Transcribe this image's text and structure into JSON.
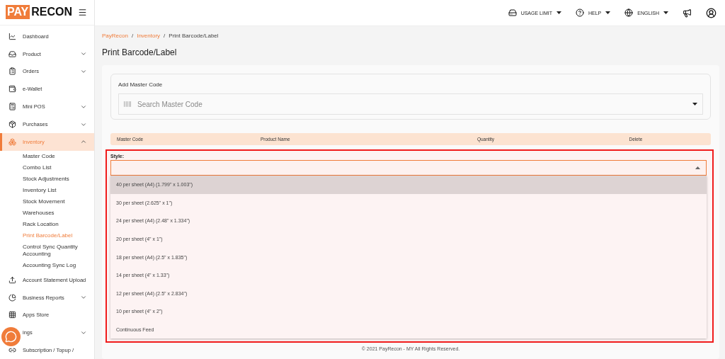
{
  "logo": {
    "part_1": "PAY",
    "part_2": "RECON"
  },
  "sidebar": {
    "items": [
      {
        "label": "Dashboard",
        "kind": "link",
        "selected": false
      },
      {
        "label": "Product",
        "kind": "group",
        "expanded": false,
        "selected": false
      },
      {
        "label": "Orders",
        "kind": "group",
        "expanded": false,
        "selected": false
      },
      {
        "label": "e-Wallet",
        "kind": "link",
        "selected": false
      },
      {
        "label": "Mini POS",
        "kind": "group",
        "expanded": false,
        "selected": false
      },
      {
        "label": "Purchases",
        "kind": "group",
        "expanded": false,
        "selected": false
      },
      {
        "label": "Inventory",
        "kind": "group",
        "expanded": true,
        "selected": true,
        "children": [
          {
            "label": "Master Code",
            "selected": false
          },
          {
            "label": "Combo List",
            "selected": false
          },
          {
            "label": "Stock Adjustments",
            "selected": false
          },
          {
            "label": "Inventory List",
            "selected": false
          },
          {
            "label": "Stock Movement",
            "selected": false
          },
          {
            "label": "Warehouses",
            "selected": false
          },
          {
            "label": "Rack Location",
            "selected": false
          },
          {
            "label": "Print Barcode/Label",
            "selected": true
          },
          {
            "label": "Control Sync Quantity Accounting",
            "selected": false
          },
          {
            "label": "Accounting Sync Log",
            "selected": false
          }
        ]
      },
      {
        "label": "Account Statement Upload",
        "kind": "link",
        "selected": false
      },
      {
        "label": "Business Reports",
        "kind": "group",
        "expanded": false,
        "selected": false
      },
      {
        "label": "Apps Store",
        "kind": "link",
        "selected": false
      },
      {
        "label": "ings",
        "kind": "group",
        "expanded": false,
        "selected": false
      },
      {
        "label": "Subscription / Topup /",
        "kind": "link",
        "selected": false
      }
    ]
  },
  "topbar": {
    "menus": [
      "USAGE LIMIT",
      "HELP",
      "ENGLISH"
    ]
  },
  "breadcrumb": [
    "PayRecon",
    "Inventory",
    "Print Barcode/Label"
  ],
  "breadcrumb_separator": "/",
  "page_title": "Print Barcode/Label",
  "add_master_code": {
    "label": "Add Master Code",
    "placeholder": "Search Master Code"
  },
  "table": {
    "columns": [
      "Master Code",
      "Product Name",
      "Quantity",
      "Delete"
    ]
  },
  "style_select": {
    "label": "Style:",
    "expanded": true,
    "options": [
      {
        "label": "40 per sheet (A4) (1.799\" x 1.003\")",
        "selected": true
      },
      {
        "label": "30 per sheet (2.625\" x 1\")",
        "selected": false
      },
      {
        "label": "24 per sheet (A4) (2.48\" x 1.334\")",
        "selected": false
      },
      {
        "label": "20 per sheet (4\" x 1\")",
        "selected": false
      },
      {
        "label": "18 per sheet (A4) (2.5\" x 1.835\")",
        "selected": false
      },
      {
        "label": "14 per sheet (4\" x 1.33\")",
        "selected": false
      },
      {
        "label": "12 per sheet (A4) (2.5\" x 2.834\")",
        "selected": false
      },
      {
        "label": "10 per sheet (4\" x 2\")",
        "selected": false
      },
      {
        "label": "Continuous Feed",
        "selected": false
      }
    ]
  },
  "footer": "© 2021 PayRecon - MY All Rights Reserved."
}
